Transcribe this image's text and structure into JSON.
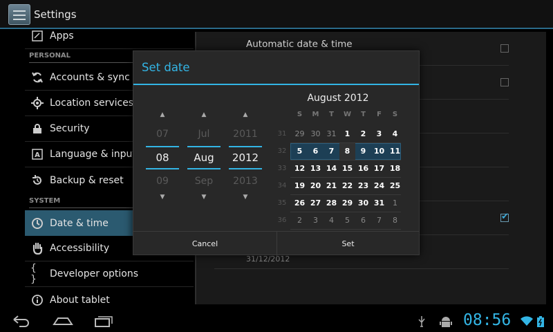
{
  "actionbar": {
    "title": "Settings",
    "icon": "settings-app-icon"
  },
  "sidebar": {
    "items": [
      {
        "label": "Apps",
        "icon": "apps-icon"
      },
      {
        "label": "Accounts & sync",
        "icon": "sync-icon"
      },
      {
        "label": "Location services",
        "icon": "location-icon"
      },
      {
        "label": "Security",
        "icon": "lock-icon"
      },
      {
        "label": "Language & input",
        "icon": "language-icon"
      },
      {
        "label": "Backup & reset",
        "icon": "backup-icon"
      },
      {
        "label": "Date & time",
        "icon": "clock-icon"
      },
      {
        "label": "Accessibility",
        "icon": "hand-icon"
      },
      {
        "label": "Developer options",
        "icon": "braces-icon"
      },
      {
        "label": "About tablet",
        "icon": "info-icon"
      }
    ],
    "sections": {
      "personal": "PERSONAL",
      "system": "SYSTEM"
    }
  },
  "detail": {
    "automatic_date_time": "Automatic date & time",
    "date_value": "31/12/2012"
  },
  "dialog": {
    "title": "Set date",
    "pickers": {
      "day": {
        "prev": "07",
        "current": "08",
        "next": "09"
      },
      "month": {
        "prev": "Jul",
        "current": "Aug",
        "next": "Sep"
      },
      "year": {
        "prev": "2011",
        "current": "2012",
        "next": "2013"
      }
    },
    "calendar": {
      "title": "August 2012",
      "weekdays": [
        "S",
        "M",
        "T",
        "W",
        "T",
        "F",
        "S"
      ],
      "weeks": [
        {
          "num": "31",
          "days": [
            "29",
            "30",
            "31",
            "1",
            "2",
            "3",
            "4"
          ]
        },
        {
          "num": "32",
          "days": [
            "5",
            "6",
            "7",
            "8",
            "9",
            "10",
            "11"
          ]
        },
        {
          "num": "33",
          "days": [
            "12",
            "13",
            "14",
            "15",
            "16",
            "17",
            "18"
          ]
        },
        {
          "num": "34",
          "days": [
            "19",
            "20",
            "21",
            "22",
            "23",
            "24",
            "25"
          ]
        },
        {
          "num": "35",
          "days": [
            "26",
            "27",
            "28",
            "29",
            "30",
            "31",
            "1"
          ]
        },
        {
          "num": "36",
          "days": [
            "2",
            "3",
            "4",
            "5",
            "6",
            "7",
            "8"
          ]
        }
      ],
      "selected_day": "8"
    },
    "cancel_label": "Cancel",
    "set_label": "Set"
  },
  "statusbar": {
    "time": "08:56"
  },
  "colors": {
    "accent": "#33b5e5",
    "selection": "#2b5a70"
  }
}
